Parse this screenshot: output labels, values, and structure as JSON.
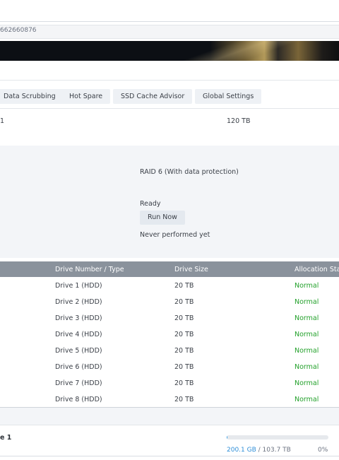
{
  "browser": {
    "url_fragment": "662660876"
  },
  "tabs": [
    {
      "label": "Data Scrubbing"
    },
    {
      "label": "Hot Spare"
    },
    {
      "label": "SSD Cache Advisor"
    },
    {
      "label": "Global Settings"
    }
  ],
  "summary": {
    "left_value": "1",
    "capacity": "120 TB"
  },
  "details": {
    "raid_type": "RAID 6 (With data protection)",
    "scrubbing_status": "Ready",
    "run_now_label": "Run Now",
    "last_run": "Never performed yet"
  },
  "drive_table": {
    "headers": [
      "Drive Number / Type",
      "Drive Size",
      "Allocation Sta"
    ],
    "rows": [
      {
        "drive": "Drive 1 (HDD)",
        "size": "20 TB",
        "status": "Normal"
      },
      {
        "drive": "Drive 2 (HDD)",
        "size": "20 TB",
        "status": "Normal"
      },
      {
        "drive": "Drive 3 (HDD)",
        "size": "20 TB",
        "status": "Normal"
      },
      {
        "drive": "Drive 4 (HDD)",
        "size": "20 TB",
        "status": "Normal"
      },
      {
        "drive": "Drive 5 (HDD)",
        "size": "20 TB",
        "status": "Normal"
      },
      {
        "drive": "Drive 6 (HDD)",
        "size": "20 TB",
        "status": "Normal"
      },
      {
        "drive": "Drive 7 (HDD)",
        "size": "20 TB",
        "status": "Normal"
      },
      {
        "drive": "Drive 8 (HDD)",
        "size": "20 TB",
        "status": "Normal"
      }
    ]
  },
  "volume": {
    "name": "e 1",
    "used": "200.1 GB",
    "total": "/ 103.7 TB",
    "percent": "0%",
    "usage_fraction": 0.002
  },
  "colors": {
    "status_normal": "#23a12b",
    "table_header_bg": "#8a929c",
    "panel_bg": "#f3f5f8",
    "usage_fill": "#3aa0e6"
  }
}
